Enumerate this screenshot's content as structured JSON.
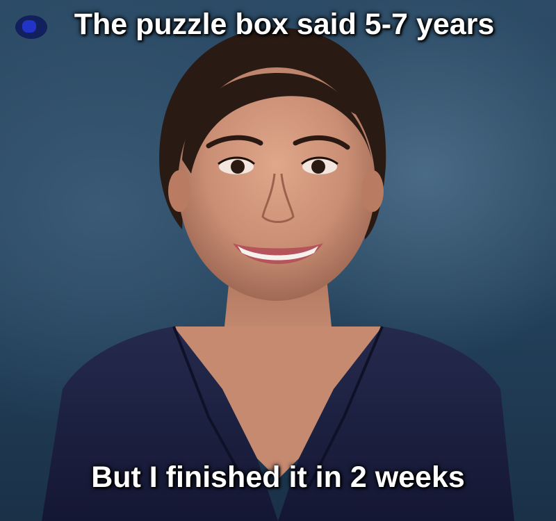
{
  "meme": {
    "top_caption": "The puzzle box said 5-7 years",
    "bottom_caption": "But I finished it in 2 weeks"
  },
  "colors": {
    "background": "#2c4b66",
    "blazer": "#1b1f3b",
    "skin": "#c98e74",
    "hair": "#2a1a14",
    "caption_text": "#ffffff"
  },
  "icons": [
    "blob-icon"
  ]
}
